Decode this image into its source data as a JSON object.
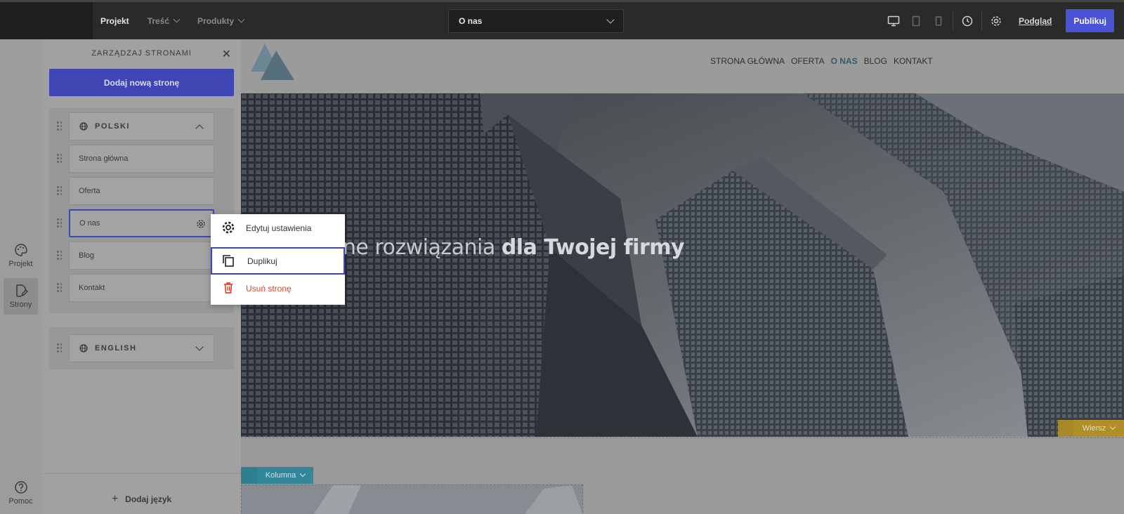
{
  "topbar": {
    "nav": [
      {
        "label": "Projekt",
        "active": true,
        "dropdown": false
      },
      {
        "label": "Treść",
        "active": false,
        "dropdown": true
      },
      {
        "label": "Produkty",
        "active": false,
        "dropdown": true
      }
    ],
    "page_select": "O nas",
    "preview": "Podgląd",
    "publish": "Publikuj",
    "icons": [
      "desktop-icon",
      "tablet-icon",
      "mobile-icon",
      "history-icon",
      "settings-gear-icon"
    ]
  },
  "rail": {
    "items": [
      {
        "label": "Projekt",
        "icon": "palette-icon"
      },
      {
        "label": "Strony",
        "icon": "pages-edit-icon"
      },
      {
        "label": "Pomoc",
        "icon": "help-icon"
      }
    ]
  },
  "panel": {
    "title": "ZARZĄDZAJ STRONAMI",
    "add_page": "Dodaj nową stronę",
    "lang_pl": "POLSKI",
    "lang_en": "ENGLISH",
    "pages": [
      "Strona główna",
      "Oferta",
      "O nas",
      "Blog",
      "Kontakt"
    ],
    "add_language": "Dodaj język"
  },
  "site": {
    "nav": [
      "STRONA GŁÓWNA",
      "OFERTA",
      "O NAS",
      "BLOG",
      "KONTAKT"
    ],
    "hero_text_light": "one rozwiązania",
    "hero_text_bold": "dla Twojej firmy",
    "row_label": "Wiersz",
    "column_label": "Kolumna"
  },
  "context_menu": {
    "items": [
      {
        "label": "Edytuj ustawienia",
        "icon": "settings-gear-icon"
      },
      {
        "label": "Duplikuj",
        "icon": "duplicate-icon"
      },
      {
        "label": "Usuń stronę",
        "icon": "trash-icon"
      }
    ]
  },
  "colors": {
    "accent": "#4a52d6",
    "danger": "#e0452b",
    "row_tag": "#b08f28",
    "column_tag": "#34879a"
  }
}
